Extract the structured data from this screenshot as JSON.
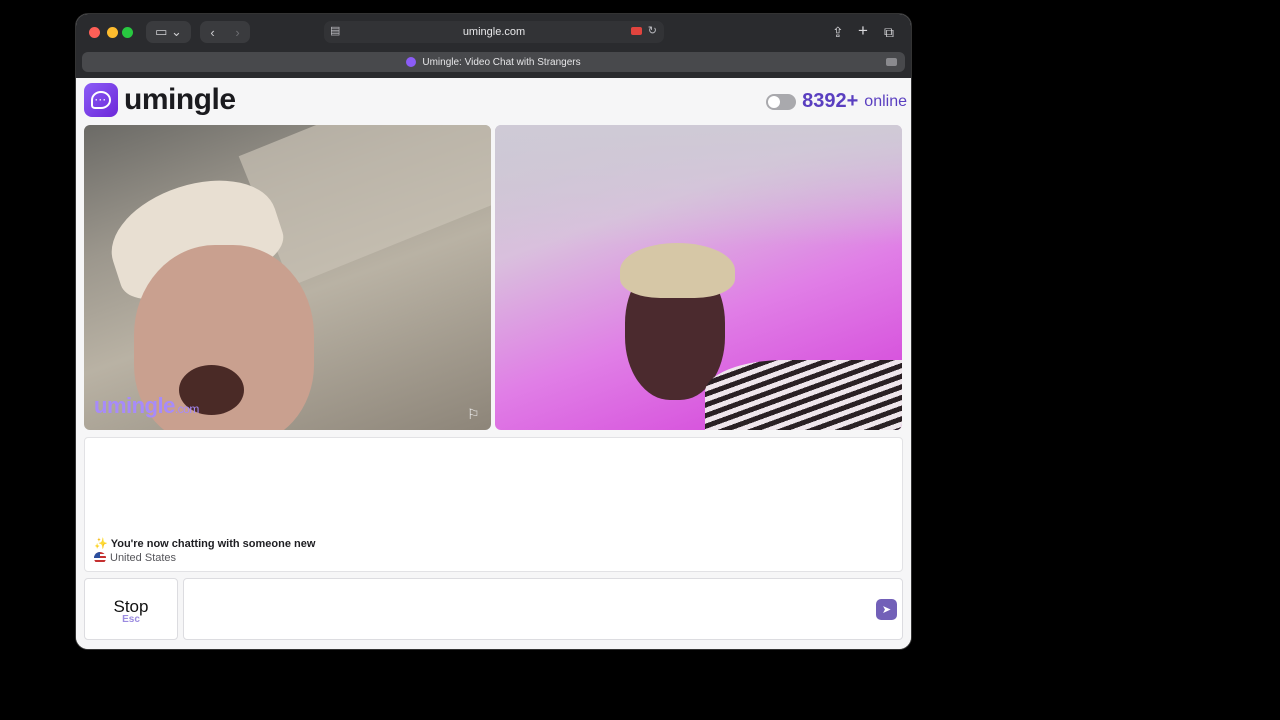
{
  "browser": {
    "url": "umingle.com",
    "tab_title": "Umingle: Video Chat with Strangers",
    "icons": {
      "sidebar": "sidebar-icon",
      "back": "chevron-left-icon",
      "forward": "chevron-right-icon",
      "share": "share-icon",
      "new_tab": "plus-icon",
      "tabs_overview": "tabs-icon"
    }
  },
  "header": {
    "brand_name": "umingle",
    "online_count": "8392+",
    "online_label": "online",
    "accent_color": "#5a3fc0"
  },
  "video": {
    "watermark_brand": "umingle",
    "watermark_domain": ".com"
  },
  "chat": {
    "status_message": "You're now chatting with someone new",
    "country": "United States"
  },
  "controls": {
    "stop_label": "Stop",
    "stop_shortcut": "Esc",
    "message_placeholder": ""
  }
}
